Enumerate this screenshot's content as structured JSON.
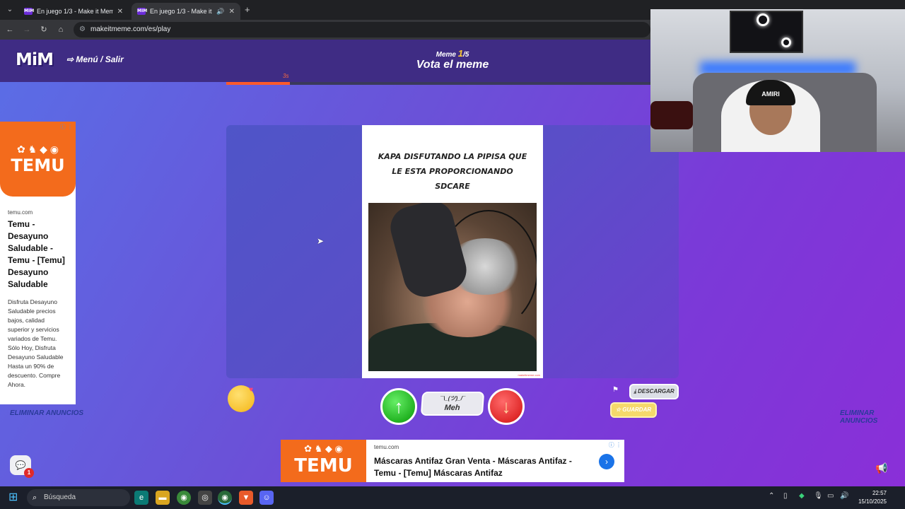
{
  "browser": {
    "tabs": [
      {
        "title": "En juego 1/3 - Make it Meme",
        "favicon": "MIM"
      },
      {
        "title": "En juego 1/3 - Make it Mem",
        "favicon": "MIM"
      }
    ],
    "url": "makeitmeme.com/es/play"
  },
  "game": {
    "logo": "MiM",
    "menu_label": "Menú / Salir",
    "round_prefix": "Meme",
    "round_current": "1",
    "round_total": "/5",
    "title": "Vota el meme",
    "timer": "3s",
    "progress_fraction": 0.15,
    "meme_caption": "KAPA DISFUTANDO LA PIPISA QUE LE ESTA PROPORCIONANDO SDCARE",
    "watermark": "makeitmeme.com",
    "vote_meh_face": "¯\\_(ツ)_/¯",
    "vote_meh_label": "Meh",
    "download_label": "DESCARGAR",
    "save_label": "GUARDAR",
    "remove_ads": "ELIMINAR ANUNCIOS",
    "chat_badge": "1"
  },
  "ad_left": {
    "brand": "TEMU",
    "domain": "temu.com",
    "title": "Temu - Desayuno Saludable - Temu - [Temu] Desayuno Saludable",
    "description": "Disfruta Desayuno Saludable precios bajos, calidad superior y servicios variados de Temu. Sólo Hoy, Disfruta Desayuno Saludable Hasta un 90% de descuento. Compre Ahora."
  },
  "ad_bottom": {
    "brand": "TEMU",
    "domain": "temu.com",
    "title": "Máscaras Antifaz Gran Venta - Máscaras Antifaz - Temu - [Temu] Máscaras Antifaz"
  },
  "webcam": {
    "cap_text": "AMIRI"
  },
  "taskbar": {
    "search_placeholder": "Búsqueda",
    "time": "22:57",
    "date": "15/10/2025"
  },
  "colors": {
    "accent": "#3f2c84",
    "timer_bar": "#ff5a2a",
    "temu_orange": "#f36b1c",
    "vote_up": "#22b322",
    "vote_down": "#e02a2a"
  }
}
